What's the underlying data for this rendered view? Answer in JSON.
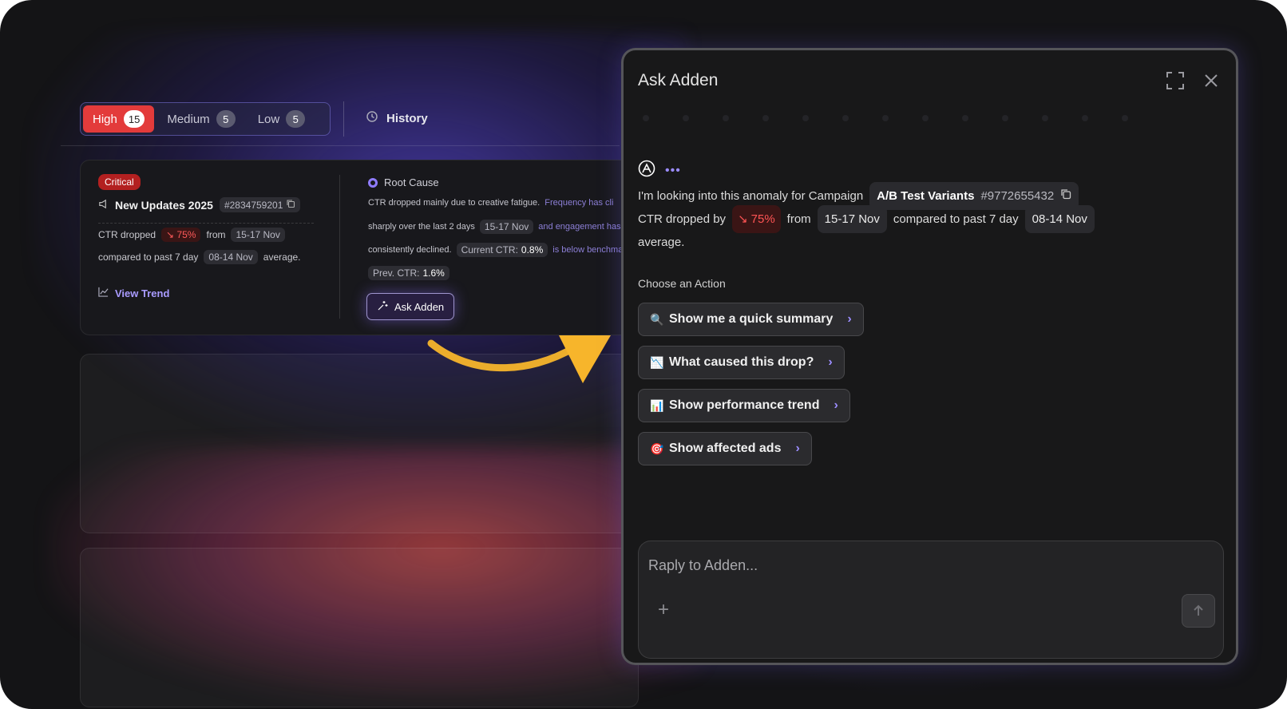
{
  "filters": {
    "tabs": [
      {
        "label": "High",
        "count": "15"
      },
      {
        "label": "Medium",
        "count": "5"
      },
      {
        "label": "Low",
        "count": "5"
      }
    ],
    "history_label": "History"
  },
  "card": {
    "severity": "Critical",
    "title": "New Updates 2025",
    "id": "#2834759201",
    "ctr_text": "CTR dropped",
    "ctr_change": "75%",
    "from_text": "from",
    "current_range": "15-17 Nov",
    "compared_text": "compared to past 7 day",
    "previous_range": "08-14 Nov",
    "average_text": "average.",
    "view_trend": "View Trend",
    "root_cause": {
      "heading": "Root Cause",
      "line1": "CTR dropped mainly due to creative fatigue.",
      "line1_faded": "Frequency has cli",
      "line2": "sharply over the last 2 days",
      "line2_range": "15-17 Nov",
      "line2_faded": "and engagement has",
      "line3": "consistently declined.",
      "current_ctr_label": "Current CTR:",
      "current_ctr_value": "0.8%",
      "line3_faded": "is below benchma",
      "prev_ctr_label": "Prev. CTR:",
      "prev_ctr_value": "1.6%"
    },
    "ask_button": "Ask Adden"
  },
  "panel": {
    "title": "Ask Adden",
    "message": {
      "intro": "I'm looking into this anomaly for Campaign",
      "campaign_name": "A/B Test Variants",
      "campaign_id": "#9772655432",
      "ctr_text": "CTR dropped by",
      "ctr_change": "75%",
      "from_text": "from",
      "current_range": "15-17 Nov",
      "compared_text": "compared to past 7 day",
      "previous_range": "08-14 Nov",
      "average_text": "average."
    },
    "choose_label": "Choose an Action",
    "actions": [
      {
        "emoji": "🔍",
        "label": "Show me a quick summary"
      },
      {
        "emoji": "📉",
        "label": "What caused this drop?"
      },
      {
        "emoji": "📊",
        "label": "Show performance trend"
      },
      {
        "emoji": "🎯",
        "label": "Show affected ads"
      }
    ],
    "reply_placeholder": "Raply to Adden..."
  },
  "colors": {
    "accent": "#8f7cff",
    "critical": "#e33b3b",
    "negative": "#ff5454",
    "arrow": "#f7b52b"
  }
}
